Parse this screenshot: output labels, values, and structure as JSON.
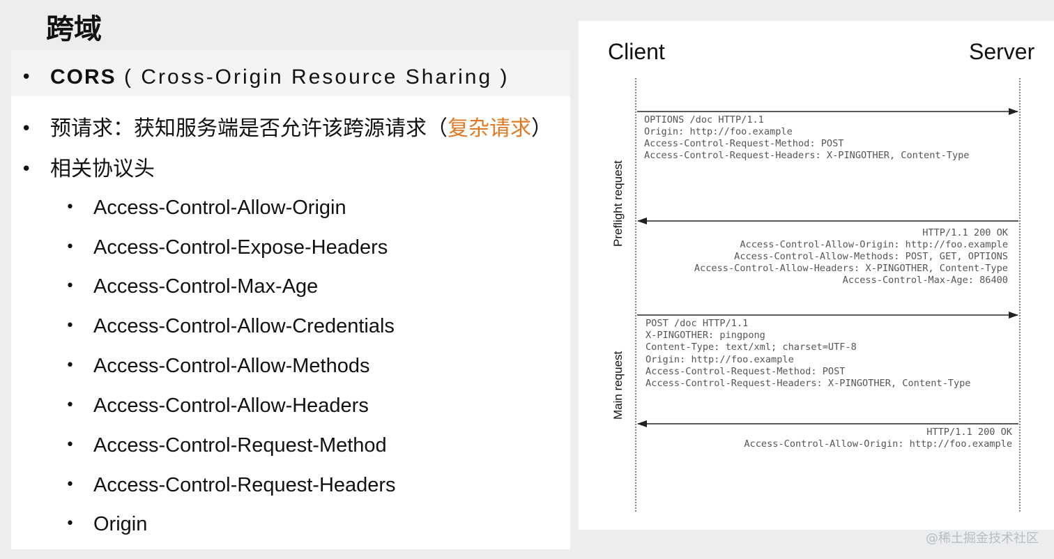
{
  "slide": {
    "title": "跨域",
    "cors_abbr": "CORS",
    "cors_full": "(   Cross-Origin  Resource  Sharing  )",
    "preflight_text": "预请求：获知服务端是否允许该跨源请求（",
    "preflight_highlight": "复杂请求",
    "preflight_close": "）",
    "headers_title": "相关协议头",
    "headers": [
      "Access-Control-Allow-Origin",
      "Access-Control-Expose-Headers",
      "Access-Control-Max-Age",
      "Access-Control-Allow-Credentials",
      "Access-Control-Allow-Methods",
      "Access-Control-Allow-Headers",
      "Access-Control-Request-Method",
      "Access-Control-Request-Headers",
      "Origin"
    ],
    "accent_color": "#e07a25"
  },
  "diagram": {
    "client_label": "Client",
    "server_label": "Server",
    "preflight_label": "Preflight request",
    "main_label": "Main request",
    "preflight_request": [
      "OPTIONS /doc HTTP/1.1",
      "Origin: http://foo.example",
      "Access-Control-Request-Method: POST",
      "Access-Control-Request-Headers: X-PINGOTHER, Content-Type"
    ],
    "preflight_response": [
      "HTTP/1.1 200 OK",
      "Access-Control-Allow-Origin: http://foo.example",
      "Access-Control-Allow-Methods: POST, GET, OPTIONS",
      "Access-Control-Allow-Headers: X-PINGOTHER, Content-Type",
      "Access-Control-Max-Age: 86400"
    ],
    "main_request": [
      "POST /doc HTTP/1.1",
      "X-PINGOTHER: pingpong",
      "Content-Type: text/xml; charset=UTF-8",
      "Origin: http://foo.example",
      "Access-Control-Request-Method: POST",
      "Access-Control-Request-Headers: X-PINGOTHER, Content-Type"
    ],
    "main_response": [
      "HTTP/1.1 200 OK",
      "Access-Control-Allow-Origin: http://foo.example"
    ]
  },
  "watermark": "@稀土掘金技术社区"
}
